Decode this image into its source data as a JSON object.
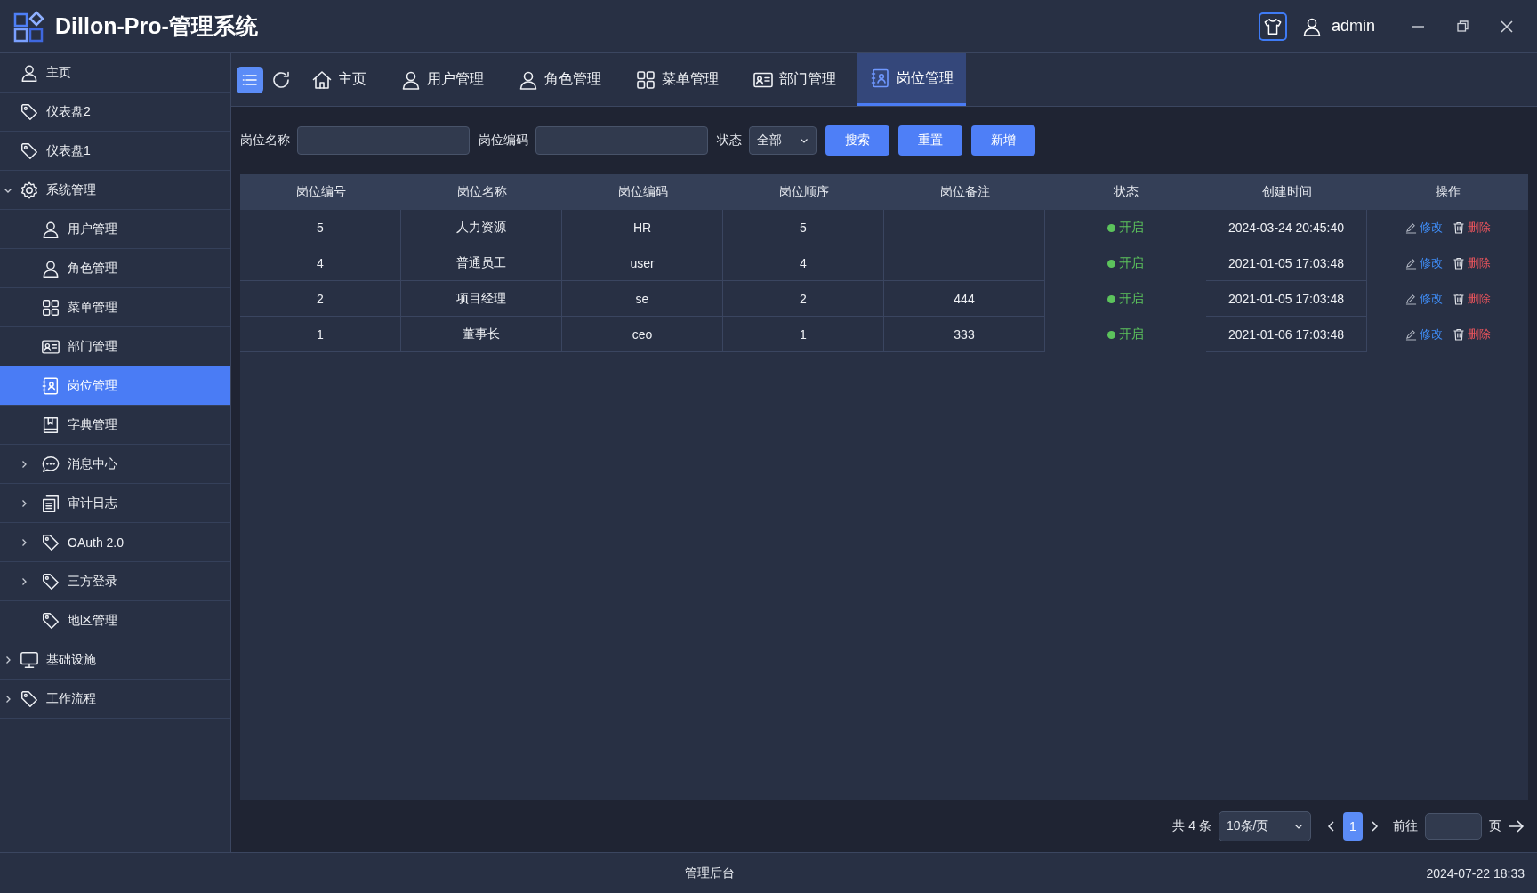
{
  "header": {
    "title": "Dillon-Pro-管理系统",
    "user": "admin"
  },
  "sidebar": {
    "items": [
      {
        "label": "主页",
        "kind": "user",
        "selected": false
      },
      {
        "label": "仪表盘2",
        "kind": "tag",
        "selected": false
      },
      {
        "label": "仪表盘1",
        "kind": "tag",
        "selected": false
      },
      {
        "label": "系统管理",
        "kind": "gear",
        "selected": false,
        "expanded": true,
        "children": [
          {
            "label": "用户管理",
            "kind": "user",
            "selected": false
          },
          {
            "label": "角色管理",
            "kind": "user",
            "selected": false
          },
          {
            "label": "菜单管理",
            "kind": "grid",
            "selected": false
          },
          {
            "label": "部门管理",
            "kind": "idcard",
            "selected": false
          },
          {
            "label": "岗位管理",
            "kind": "post",
            "selected": true
          },
          {
            "label": "字典管理",
            "kind": "book",
            "selected": false
          },
          {
            "label": "消息中心",
            "kind": "chat",
            "selected": false,
            "expanded": false
          },
          {
            "label": "审计日志",
            "kind": "doc",
            "selected": false,
            "expanded": false
          },
          {
            "label": "OAuth 2.0",
            "kind": "tag",
            "selected": false,
            "expanded": false
          },
          {
            "label": "三方登录",
            "kind": "tag",
            "selected": false,
            "expanded": false
          },
          {
            "label": "地区管理",
            "kind": "tag",
            "selected": false
          }
        ]
      },
      {
        "label": "基础设施",
        "kind": "monitor",
        "selected": false,
        "expanded": false
      },
      {
        "label": "工作流程",
        "kind": "tag",
        "selected": false,
        "expanded": false
      }
    ]
  },
  "tabs": [
    {
      "label": "主页",
      "kind": "home",
      "selected": false
    },
    {
      "label": "用户管理",
      "kind": "user",
      "selected": false
    },
    {
      "label": "角色管理",
      "kind": "user",
      "selected": false
    },
    {
      "label": "菜单管理",
      "kind": "grid",
      "selected": false
    },
    {
      "label": "部门管理",
      "kind": "idcard",
      "selected": false
    },
    {
      "label": "岗位管理",
      "kind": "post",
      "selected": true
    }
  ],
  "filters": {
    "fields": [
      {
        "label": "岗位名称",
        "kind": "input"
      },
      {
        "label": "岗位编码",
        "kind": "input"
      },
      {
        "label": "状态",
        "kind": "select",
        "value": "全部"
      }
    ],
    "buttons": [
      "搜索",
      "重置",
      "新增"
    ]
  },
  "table": {
    "columns": [
      "岗位编号",
      "岗位名称",
      "岗位编码",
      "岗位顺序",
      "岗位备注",
      "状态",
      "创建时间",
      "操作"
    ],
    "rows": [
      {
        "id": "5",
        "name": "人力资源",
        "code": "HR",
        "order": "5",
        "status": "开启",
        "color": "#5cc35c",
        "created": "2024-03-24 20:45:40",
        "edit": "修改",
        "delete": "删除"
      },
      {
        "id": "4",
        "name": "普通员工",
        "code": "user",
        "order": "4",
        "status": "开启",
        "color": "#5cc35c",
        "created": "2021-01-05 17:03:48",
        "edit": "修改",
        "delete": "删除"
      },
      {
        "id": "2",
        "name": "项目经理",
        "code": "se",
        "order": "2",
        "remark": "444",
        "status": "开启",
        "color": "#5cc35c",
        "created": "2021-01-05 17:03:48",
        "edit": "修改",
        "delete": "删除"
      },
      {
        "id": "1",
        "name": "董事长",
        "code": "ceo",
        "order": "1",
        "remark": "333",
        "status": "开启",
        "color": "#5cc35c",
        "created": "2021-01-06 17:03:48",
        "edit": "修改",
        "delete": "删除"
      }
    ]
  },
  "pager": {
    "total": "共 4 条",
    "page_size": "10条/页",
    "pages": [
      {
        "label": "1",
        "selected": true
      }
    ],
    "goto": "前往",
    "page_unit": "页"
  },
  "footer": {
    "center": "管理后台",
    "datetime": "2024-07-22 18:33"
  }
}
